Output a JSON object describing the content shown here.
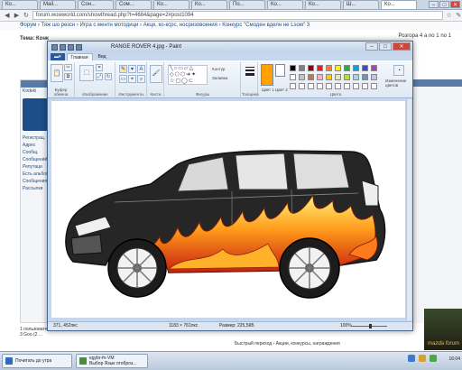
{
  "browser": {
    "tabs": [
      "Ко...",
      "Mail...",
      "Сон...",
      "Сом...",
      "Ко...",
      "Ко...",
      "По...",
      "Ко...",
      "Ко...",
      "Ш...",
      "Ко..."
    ],
    "address": "forum.wowworld.com/showthread.php?t=4684&page=2#post1094",
    "breadcrumb": "Форум › Тяж шо резсн › Игра с ментн мотодици › Акци, ко-ксрс, носризовоения › Конкурс \"Смоден вделн не Lsoм\" 3",
    "topic_title": "Тема: Конк",
    "page_info": "Розгора 4 a no 1 no 1"
  },
  "forum": {
    "left_header": "Kodeki",
    "left_lines": [
      "Регистрац.",
      "Адрес",
      "Сообщ.",
      "Сообщений",
      "Репутаци",
      "Есть альбом",
      "Сообщения",
      "Рассылки"
    ],
    "bottom_lines": [
      "1 пользовате...",
      "3 Gоо (2 ..."
    ],
    "footer": "Быстрый переход › Акции, конкурсы, награждения",
    "mascot_text": "mazda forum"
  },
  "paint": {
    "title": "RANGE ROVER 4.jpg - Paint",
    "tabs": {
      "menu": "▬▾",
      "home": "Главная",
      "view": "Вид"
    },
    "groups": {
      "clipboard": "Буфер обмена",
      "image": "Изображение",
      "tools": "Инструменты",
      "brushes": "Кисти",
      "shapes": "Фигуры",
      "size": "Толщина",
      "color1": "Цвет 1",
      "color2": "Цвет 2",
      "colors": "Цвета",
      "edit_colors": "Изменение цветов",
      "outline": "Контур",
      "fill": "Заливка"
    },
    "palette": [
      "#000000",
      "#7f7f7f",
      "#880015",
      "#ed1c24",
      "#ff7f27",
      "#fff200",
      "#22b14c",
      "#00a2e8",
      "#3f48cc",
      "#a349a4",
      "#ffffff",
      "#c3c3c3",
      "#b97a57",
      "#ffaec9",
      "#ffc90e",
      "#efe4b0",
      "#b5e61d",
      "#99d9ea",
      "#7092be",
      "#c8bfe7"
    ],
    "color1": "#ffa200",
    "color2": "#ffffff",
    "status": {
      "cursor": "371, 452пкс",
      "size": "1183 × 761пкс",
      "filesize": "Размер: 225,5КБ",
      "zoom": "100%"
    }
  },
  "taskbar": {
    "items": [
      "Почитать до утра"
    ],
    "items2": [
      "egybr-fn-VM",
      "Выбор Язык отоброз..."
    ],
    "clock": "16:04"
  }
}
